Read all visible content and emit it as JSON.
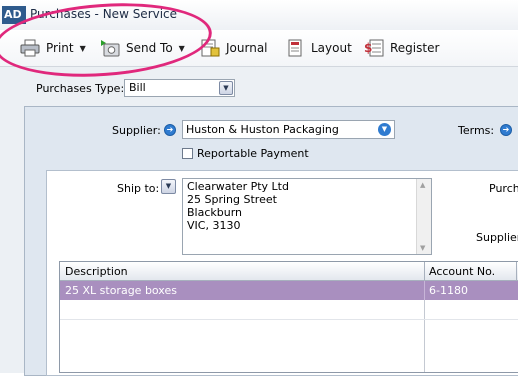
{
  "window": {
    "icon_text": "AD",
    "title": "Purchases - New Service"
  },
  "toolbar": {
    "print_label": "Print",
    "send_to_label": "Send To",
    "journal_label": "Journal",
    "layout_label": "Layout",
    "register_label": "Register"
  },
  "colors": {
    "highlight_ring": "#e0287c",
    "selected_row": "#a98fbf",
    "info_arrow": "#2f7bd0"
  },
  "form": {
    "purchase_type_label": "Purchases Type:",
    "purchase_type_value": "Bill",
    "supplier_label": "Supplier:",
    "supplier_value": "Huston & Huston Packaging",
    "terms_label": "Terms:",
    "reportable_payment_label": "Reportable Payment",
    "reportable_payment_checked": false,
    "ship_to_label": "Ship to:",
    "ship_to_lines": [
      "Clearwater Pty Ltd",
      "25 Spring Street",
      "Blackburn",
      "VIC, 3130"
    ],
    "purchase_no_label": "Purch",
    "supplier_inv_label": "Supplier"
  },
  "table": {
    "columns": [
      "Description",
      "Account No."
    ],
    "rows": [
      {
        "description": "25 XL storage boxes",
        "account": "6-1180"
      }
    ]
  }
}
